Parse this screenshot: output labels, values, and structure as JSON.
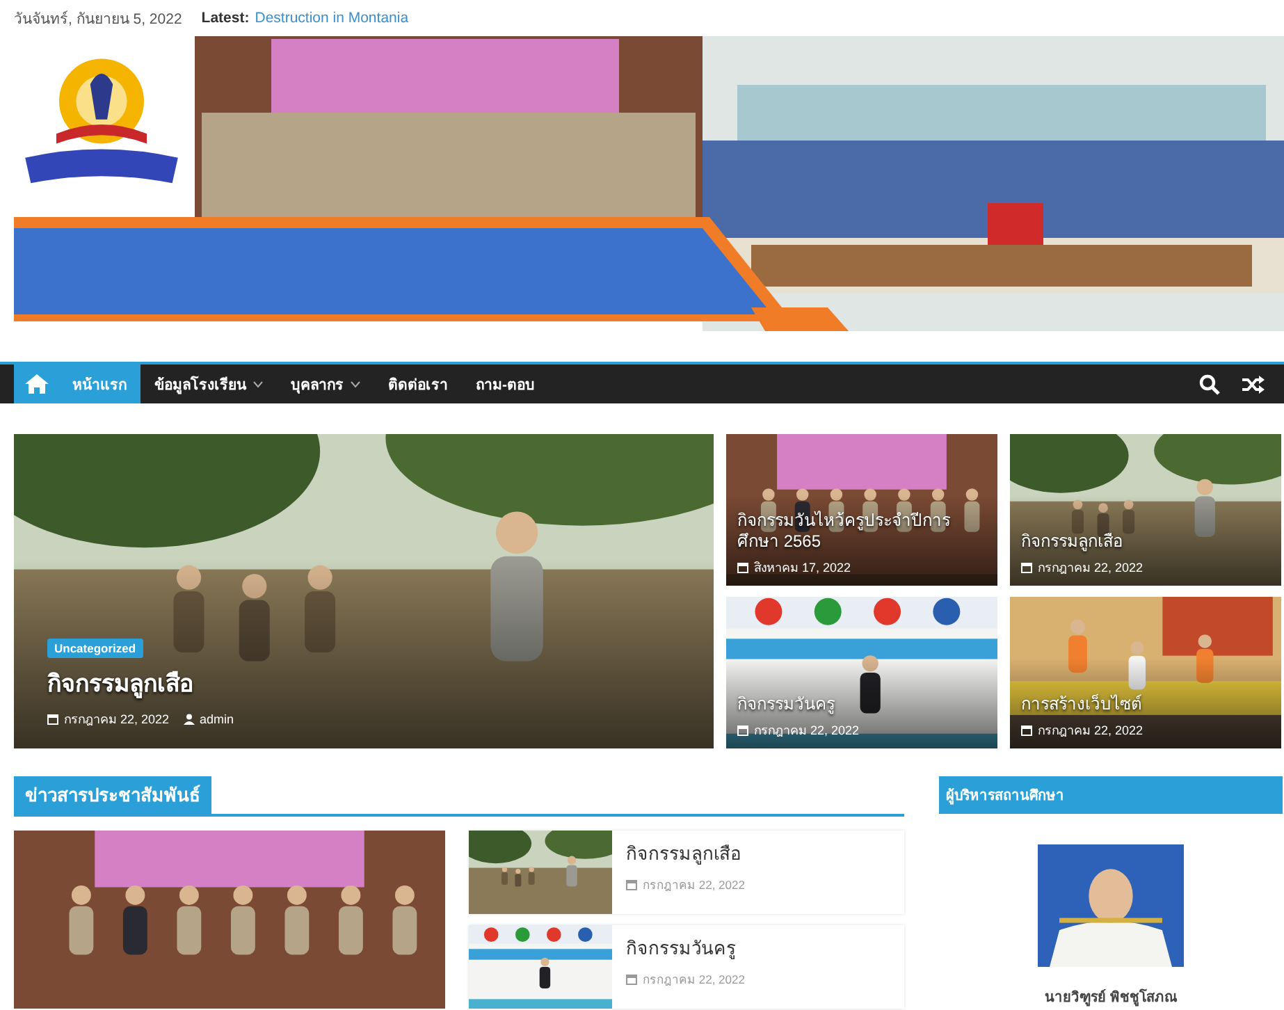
{
  "top_bar": {
    "date": "วันจันทร์, กันยายน 5, 2022",
    "latest_label": "Latest:",
    "latest_link": "Destruction in Montania"
  },
  "nav": {
    "items": [
      {
        "label": "หน้าแรก",
        "selected": true,
        "dropdown": false
      },
      {
        "label": "ข้อมูลโรงเรียน",
        "selected": false,
        "dropdown": true
      },
      {
        "label": "บุคลากร",
        "selected": false,
        "dropdown": true
      },
      {
        "label": "ติดต่อเรา",
        "selected": false,
        "dropdown": false
      },
      {
        "label": "ถาม-ตอบ",
        "selected": false,
        "dropdown": false
      }
    ]
  },
  "featured": {
    "main": {
      "kind": "field",
      "tag": "Uncategorized",
      "title": "กิจกรรมลูกเสือ",
      "date": "กรกฎาคม 22, 2022",
      "author": "admin"
    },
    "cards": [
      {
        "kind": "group",
        "title": "กิจกรรมวันไหว้ครูประจำปีการศึกษา 2565",
        "date": "สิงหาคม 17, 2022"
      },
      {
        "kind": "field",
        "title": "กิจกรรมลูกเสือ",
        "date": "กรกฎาคม 22, 2022"
      },
      {
        "kind": "sign",
        "title": "กิจกรรมวันครู",
        "date": "กรกฎาคม 22, 2022"
      },
      {
        "kind": "office",
        "title": "การสร้างเว็บไซต์",
        "date": "กรกฎาคม 22, 2022"
      }
    ]
  },
  "news": {
    "heading": "ข่าวสารประชาสัมพันธ์",
    "lead": {
      "kind": "group"
    },
    "items": [
      {
        "kind": "field",
        "title": "กิจกรรมลูกเสือ",
        "date": "กรกฎาคม 22, 2022"
      },
      {
        "kind": "sign",
        "title": "กิจกรรมวันครู",
        "date": "กรกฎาคม 22, 2022"
      }
    ]
  },
  "sidebar": {
    "heading": "ผู้บริหารสถานศึกษา",
    "photo": {
      "kind": "portrait"
    },
    "name": "นายวิฑูรย์ พิชชูโสภณ"
  }
}
